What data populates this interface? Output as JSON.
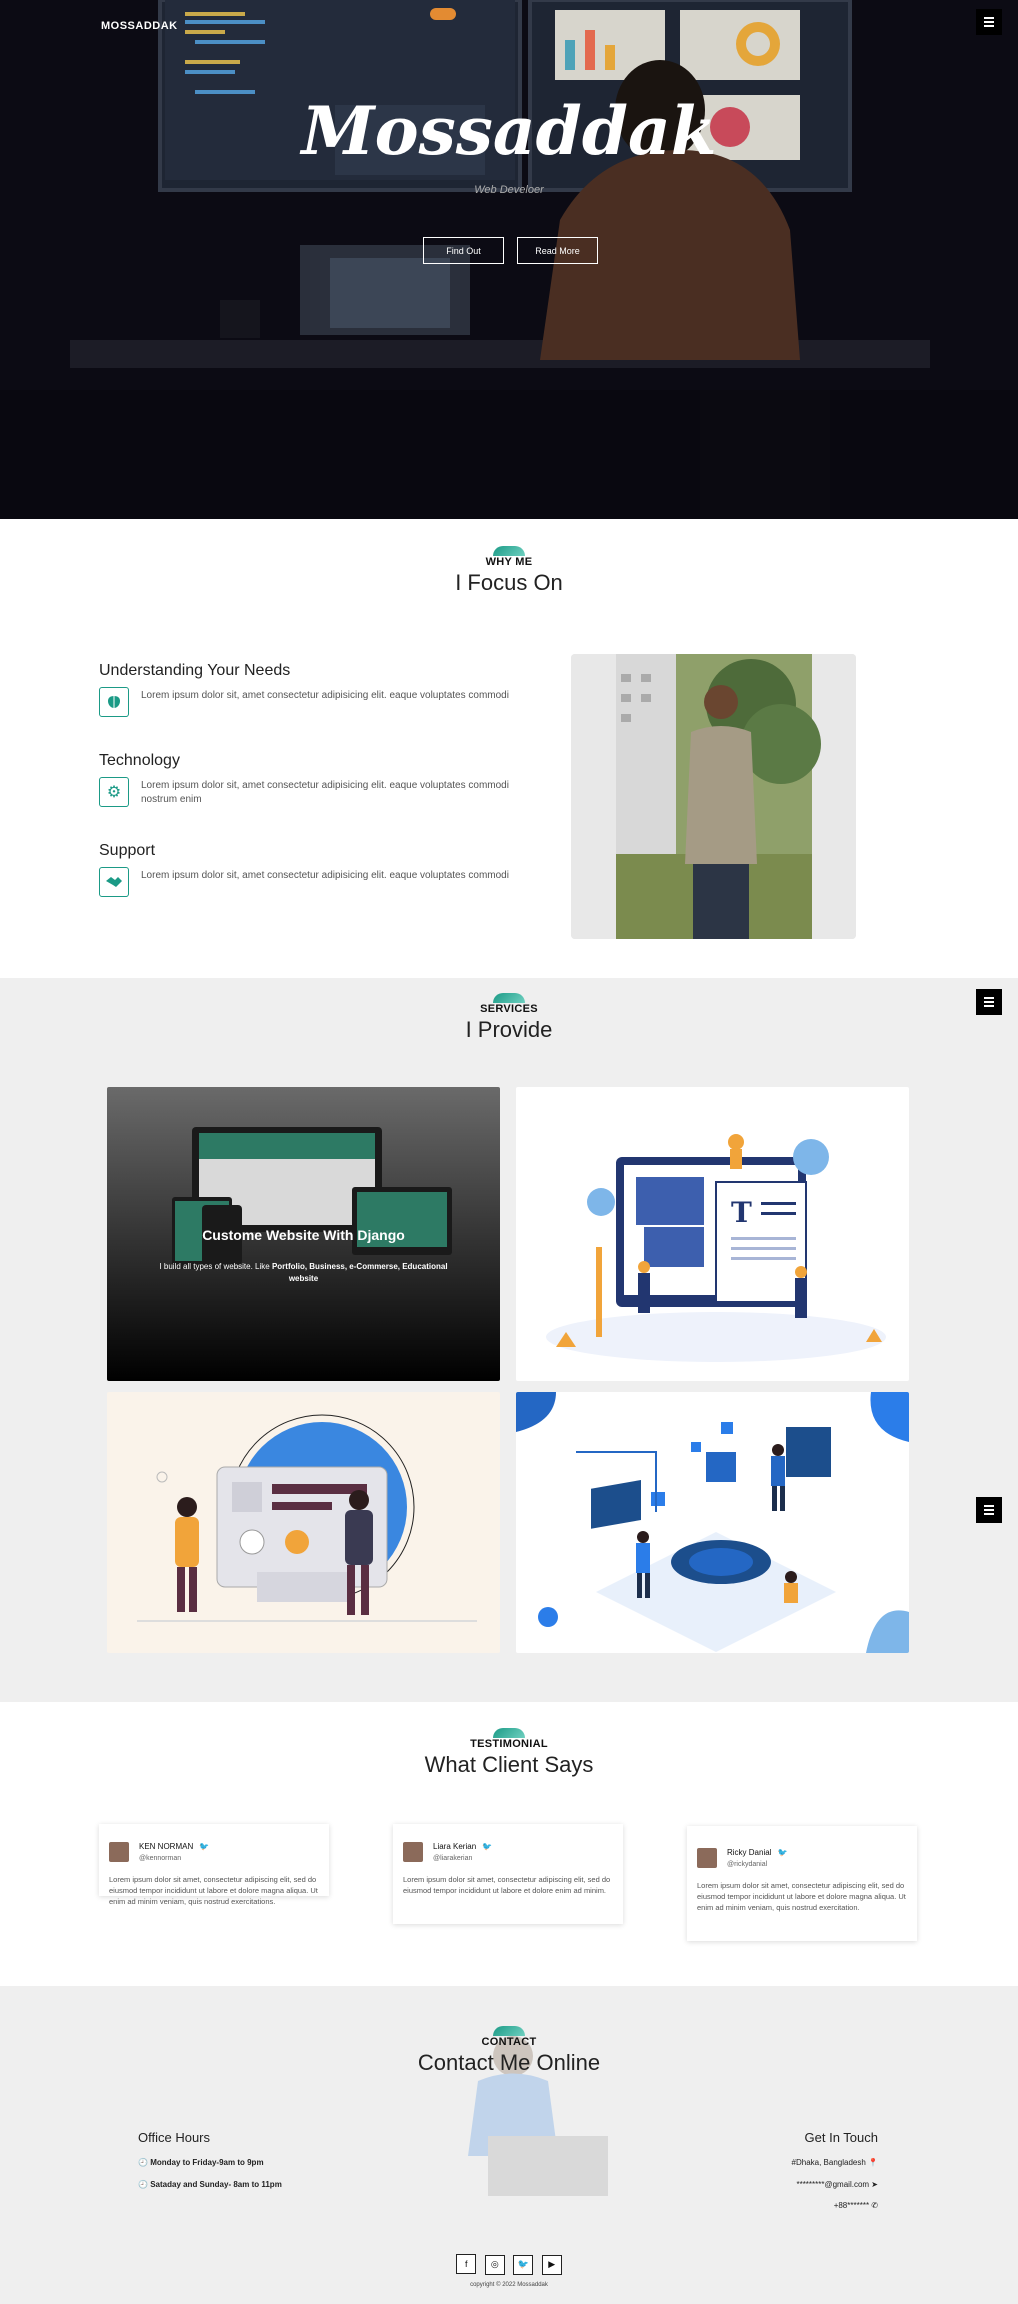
{
  "header": {
    "logo": "MOSSADDAK",
    "menu_icon": "hamburger-menu-icon"
  },
  "hero": {
    "title": "Mossaddak",
    "subtitle": "Web Develoer",
    "btn_find": "Find Out",
    "btn_read": "Read More"
  },
  "focus": {
    "kicker": "WHY ME",
    "heading": "I Focus On",
    "items": [
      {
        "title": "Understanding Your Needs",
        "text": "Lorem ipsum dolor sit, amet consectetur adipisicing elit. eaque voluptates commodi",
        "icon": "brain-icon"
      },
      {
        "title": "Technology",
        "text": "Lorem ipsum dolor sit, amet consectetur adipisicing elit. eaque voluptates commodi nostrum enim",
        "icon": "gears-icon"
      },
      {
        "title": "Support",
        "text": "Lorem ipsum dolor sit, amet consectetur adipisicing elit. eaque voluptates commodi",
        "icon": "handshake-icon"
      }
    ]
  },
  "services": {
    "kicker": "SERVICES",
    "heading": "I Provide",
    "card1_title": "Custome Website With Django",
    "card1_text_pre": "I build all types of website. Like ",
    "card1_text_bold": "Portfolio, Business, e-Commerse, Educational website"
  },
  "testimonial": {
    "kicker": "TESTIMONIAL",
    "heading": "What Client Says",
    "items": [
      {
        "name": "KEN NORMAN",
        "handle": "@kennorman",
        "text": "Lorem ipsum dolor sit amet, consectetur adipiscing elit, sed do eiusmod tempor incididunt ut labore et dolore magna aliqua. Ut enim ad minim veniam, quis nostrud exercitations."
      },
      {
        "name": "Liara Kerian",
        "handle": "@liarakerian",
        "text": "Lorem ipsum dolor sit amet, consectetur adipiscing elit, sed do eiusmod tempor incididunt ut labore et dolore enim ad minim."
      },
      {
        "name": "Ricky Danial",
        "handle": "@rickydanial",
        "text": "Lorem ipsum dolor sit amet, consectetur adipiscing elit, sed do eiusmod tempor incididunt ut labore et dolore magna aliqua. Ut enim ad minim veniam, quis nostrud exercitation."
      }
    ]
  },
  "contact": {
    "kicker": "CONTACT",
    "heading": "Contact Me Online",
    "office_title": "Office Hours",
    "office_1": "Monday to Friday-9am to 9pm",
    "office_2": "Sataday and Sunday- 8am to 11pm",
    "touch_title": "Get In Touch",
    "address": "#Dhaka, Bangladesh",
    "email": "*********@gmail.com",
    "phone": "+88*******",
    "copyright": "copyright © 2022 Mossaddak"
  },
  "colors": {
    "accent": "#1b9a86",
    "dark": "#0b0a13",
    "section_gray": "#efefef"
  }
}
